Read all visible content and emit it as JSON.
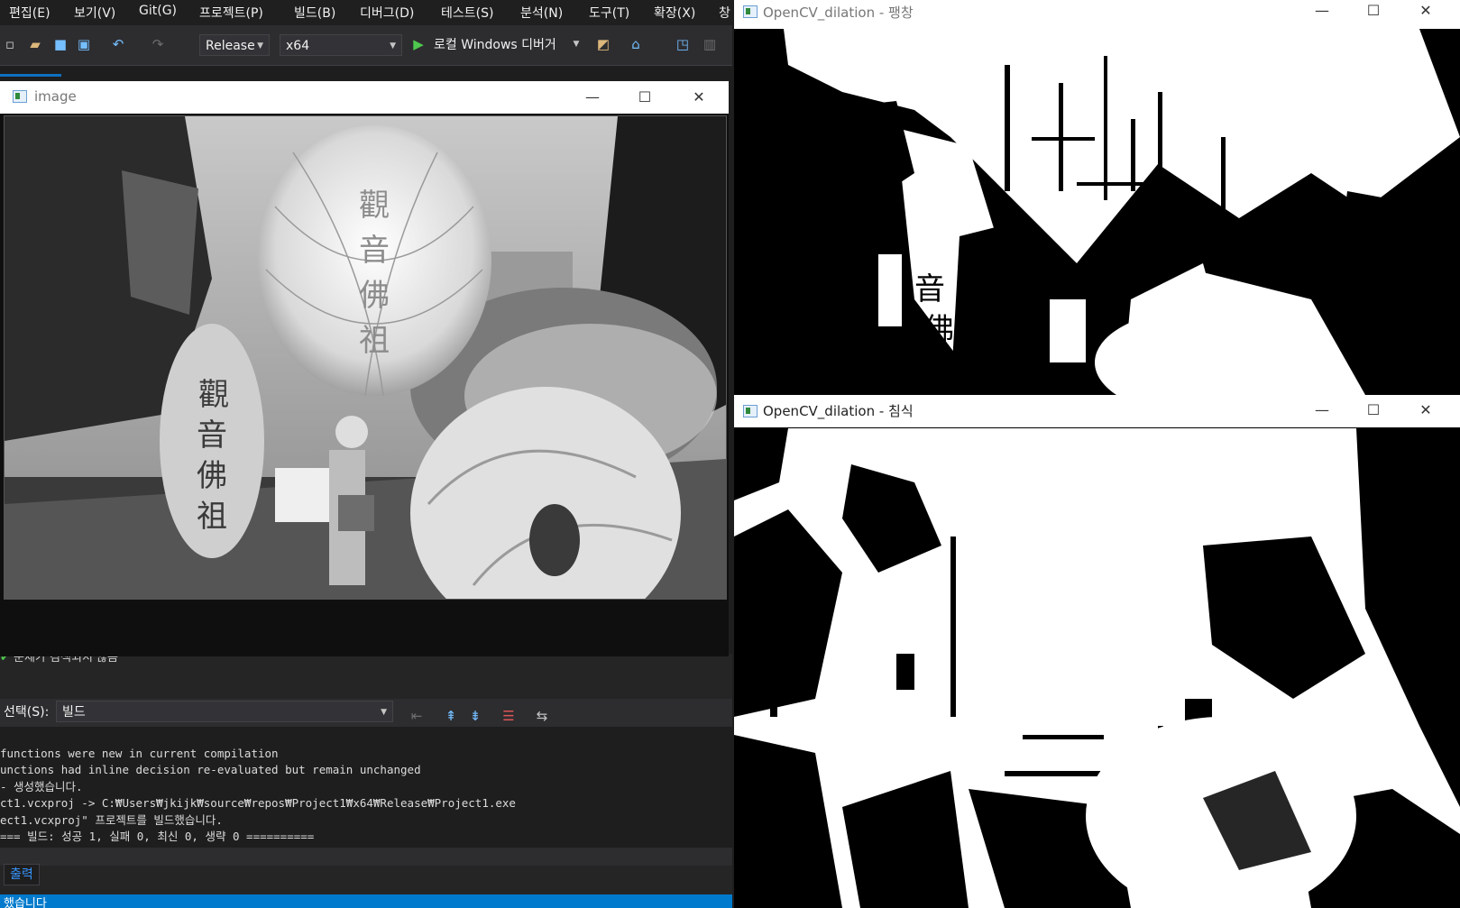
{
  "menu": [
    "편집(E)",
    "보기(V)",
    "Git(G)",
    "프로젝트(P)",
    "빌드(B)",
    "디버그(D)",
    "테스트(S)",
    "분석(N)",
    "도구(T)",
    "확장(X)",
    "창"
  ],
  "toolbar": {
    "config": "Release",
    "platform": "x64",
    "debugger": "로컬 Windows 디버거"
  },
  "windows": {
    "image": {
      "title": "image"
    },
    "dilation": {
      "title": "OpenCV_dilation - 팽창"
    },
    "erosion": {
      "title": "OpenCV_dilation - 침식"
    }
  },
  "controls": {
    "minimize": "—",
    "maximize": "☐",
    "close": "✕"
  },
  "output": {
    "issues": "문제가 검색되지 않음",
    "select_label": "선택(S):",
    "source": "빌드",
    "lines": [
      "functions were new in current compilation",
      "unctions had inline decision re-evaluated but remain unchanged",
      "- 생성했습니다.",
      "ct1.vcxproj -> C:₩Users₩jkijk₩source₩repos₩Project1₩x64₩Release₩Project1.exe",
      "ect1.vcxproj\" 프로젝트를 빌드했습니다.",
      "=== 빌드: 성공 1, 실패 0, 최신 0, 생략 0 =========="
    ],
    "tab": "출력"
  },
  "status": "했습니다",
  "colors": {
    "accent": "#007acc",
    "vs_bg": "#1e1e1e"
  }
}
